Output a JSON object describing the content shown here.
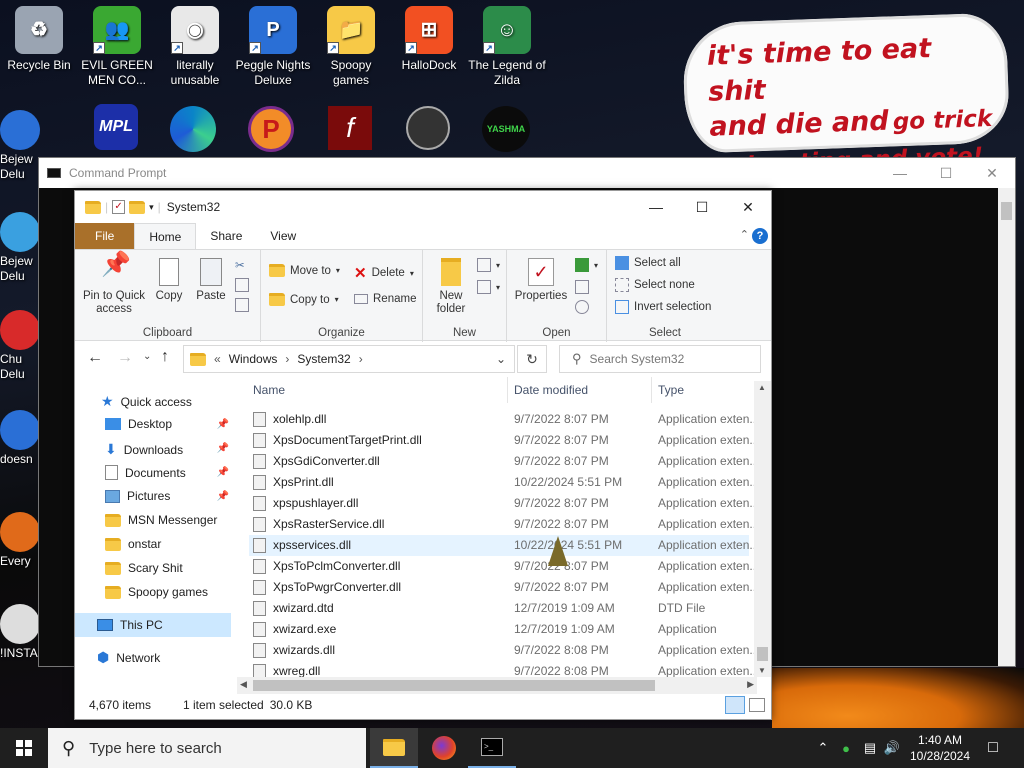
{
  "desktop": {
    "icons": [
      {
        "label": "Recycle Bin",
        "color": "#9aa4b2",
        "glyph": "♻"
      },
      {
        "label": "EVIL GREEN MEN CO...",
        "color": "#3aa832",
        "glyph": "👥"
      },
      {
        "label": "literally unusable",
        "color": "#e8e8e8",
        "glyph": "◉"
      },
      {
        "label": "Peggle Nights Deluxe",
        "color": "#2a6fd6",
        "glyph": "P"
      },
      {
        "label": "Spoopy games",
        "color": "#f7c947",
        "glyph": "📁"
      },
      {
        "label": "HalloDock",
        "color": "#f25022",
        "glyph": "⊞"
      },
      {
        "label": "The Legend of Zilda",
        "color": "#2c8c4a",
        "glyph": "☺"
      }
    ],
    "row2_icons": [
      "MPL",
      "edge",
      "P",
      "flash",
      "remote",
      "YASHMA"
    ],
    "left_labels": [
      "Bejew Delu",
      "Bejew Delu",
      "Chu Delu",
      "doesn",
      "Every",
      "!INSTA"
    ],
    "banner": {
      "line1": "it's time to eat shit",
      "line2a": "and die and",
      "line2b": "go trick",
      "line3": "or treating and vote!"
    }
  },
  "cmd": {
    "title": "Command Prompt"
  },
  "explorer": {
    "title": "System32",
    "tabs": {
      "file": "File",
      "home": "Home",
      "share": "Share",
      "view": "View"
    },
    "ribbon": {
      "pin": "Pin to Quick access",
      "copy": "Copy",
      "paste": "Paste",
      "clipboard": "Clipboard",
      "move_to": "Move to",
      "copy_to": "Copy to",
      "delete": "Delete",
      "rename": "Rename",
      "organize": "Organize",
      "new_folder": "New folder",
      "new": "New",
      "properties": "Properties",
      "open": "Open",
      "select_all": "Select all",
      "select_none": "Select none",
      "invert_selection": "Invert selection",
      "select": "Select"
    },
    "address": {
      "overflow": "«",
      "crumbs": [
        "Windows",
        "System32"
      ],
      "search_placeholder": "Search System32"
    },
    "nav": [
      {
        "label": "Quick access",
        "icon": "star-icon",
        "pinned": false
      },
      {
        "label": "Desktop",
        "icon": "desktop-icon",
        "pinned": true
      },
      {
        "label": "Downloads",
        "icon": "download-icon",
        "pinned": true
      },
      {
        "label": "Documents",
        "icon": "document-icon",
        "pinned": true
      },
      {
        "label": "Pictures",
        "icon": "picture-icon",
        "pinned": true
      },
      {
        "label": "MSN Messenger",
        "icon": "folder-icon",
        "pinned": false
      },
      {
        "label": "onstar",
        "icon": "folder-icon",
        "pinned": false
      },
      {
        "label": "Scary Shit",
        "icon": "folder-icon",
        "pinned": false
      },
      {
        "label": "Spoopy games",
        "icon": "folder-icon",
        "pinned": false
      },
      {
        "label": "This PC",
        "icon": "pc-icon",
        "pinned": false
      },
      {
        "label": "Network",
        "icon": "network-icon",
        "pinned": false
      }
    ],
    "columns": {
      "name": "Name",
      "date": "Date modified",
      "type": "Type"
    },
    "files": [
      {
        "name": "xolehlp.dll",
        "date": "9/7/2022 8:07 PM",
        "type": "Application exten..."
      },
      {
        "name": "XpsDocumentTargetPrint.dll",
        "date": "9/7/2022 8:07 PM",
        "type": "Application exten..."
      },
      {
        "name": "XpsGdiConverter.dll",
        "date": "9/7/2022 8:07 PM",
        "type": "Application exten..."
      },
      {
        "name": "XpsPrint.dll",
        "date": "10/22/2024 5:51 PM",
        "type": "Application exten..."
      },
      {
        "name": "xpspushlayer.dll",
        "date": "9/7/2022 8:07 PM",
        "type": "Application exten..."
      },
      {
        "name": "XpsRasterService.dll",
        "date": "9/7/2022 8:07 PM",
        "type": "Application exten..."
      },
      {
        "name": "xpsservices.dll",
        "date": "10/22/2024 5:51 PM",
        "type": "Application exten..."
      },
      {
        "name": "XpsToPclmConverter.dll",
        "date": "9/7/2022 8:07 PM",
        "type": "Application exten..."
      },
      {
        "name": "XpsToPwgrConverter.dll",
        "date": "9/7/2022 8:07 PM",
        "type": "Application exten..."
      },
      {
        "name": "xwizard.dtd",
        "date": "12/7/2019 1:09 AM",
        "type": "DTD File"
      },
      {
        "name": "xwizard.exe",
        "date": "12/7/2019 1:09 AM",
        "type": "Application"
      },
      {
        "name": "xwizards.dll",
        "date": "9/7/2022 8:08 PM",
        "type": "Application exten..."
      },
      {
        "name": "xwreg.dll",
        "date": "9/7/2022 8:08 PM",
        "type": "Application exten..."
      }
    ],
    "selected_index": 6,
    "status": {
      "count": "4,670 items",
      "selected": "1 item selected",
      "size": "30.0 KB"
    }
  },
  "taskbar": {
    "search_placeholder": "Type here to search",
    "time": "1:40 AM",
    "date": "10/28/2024"
  }
}
